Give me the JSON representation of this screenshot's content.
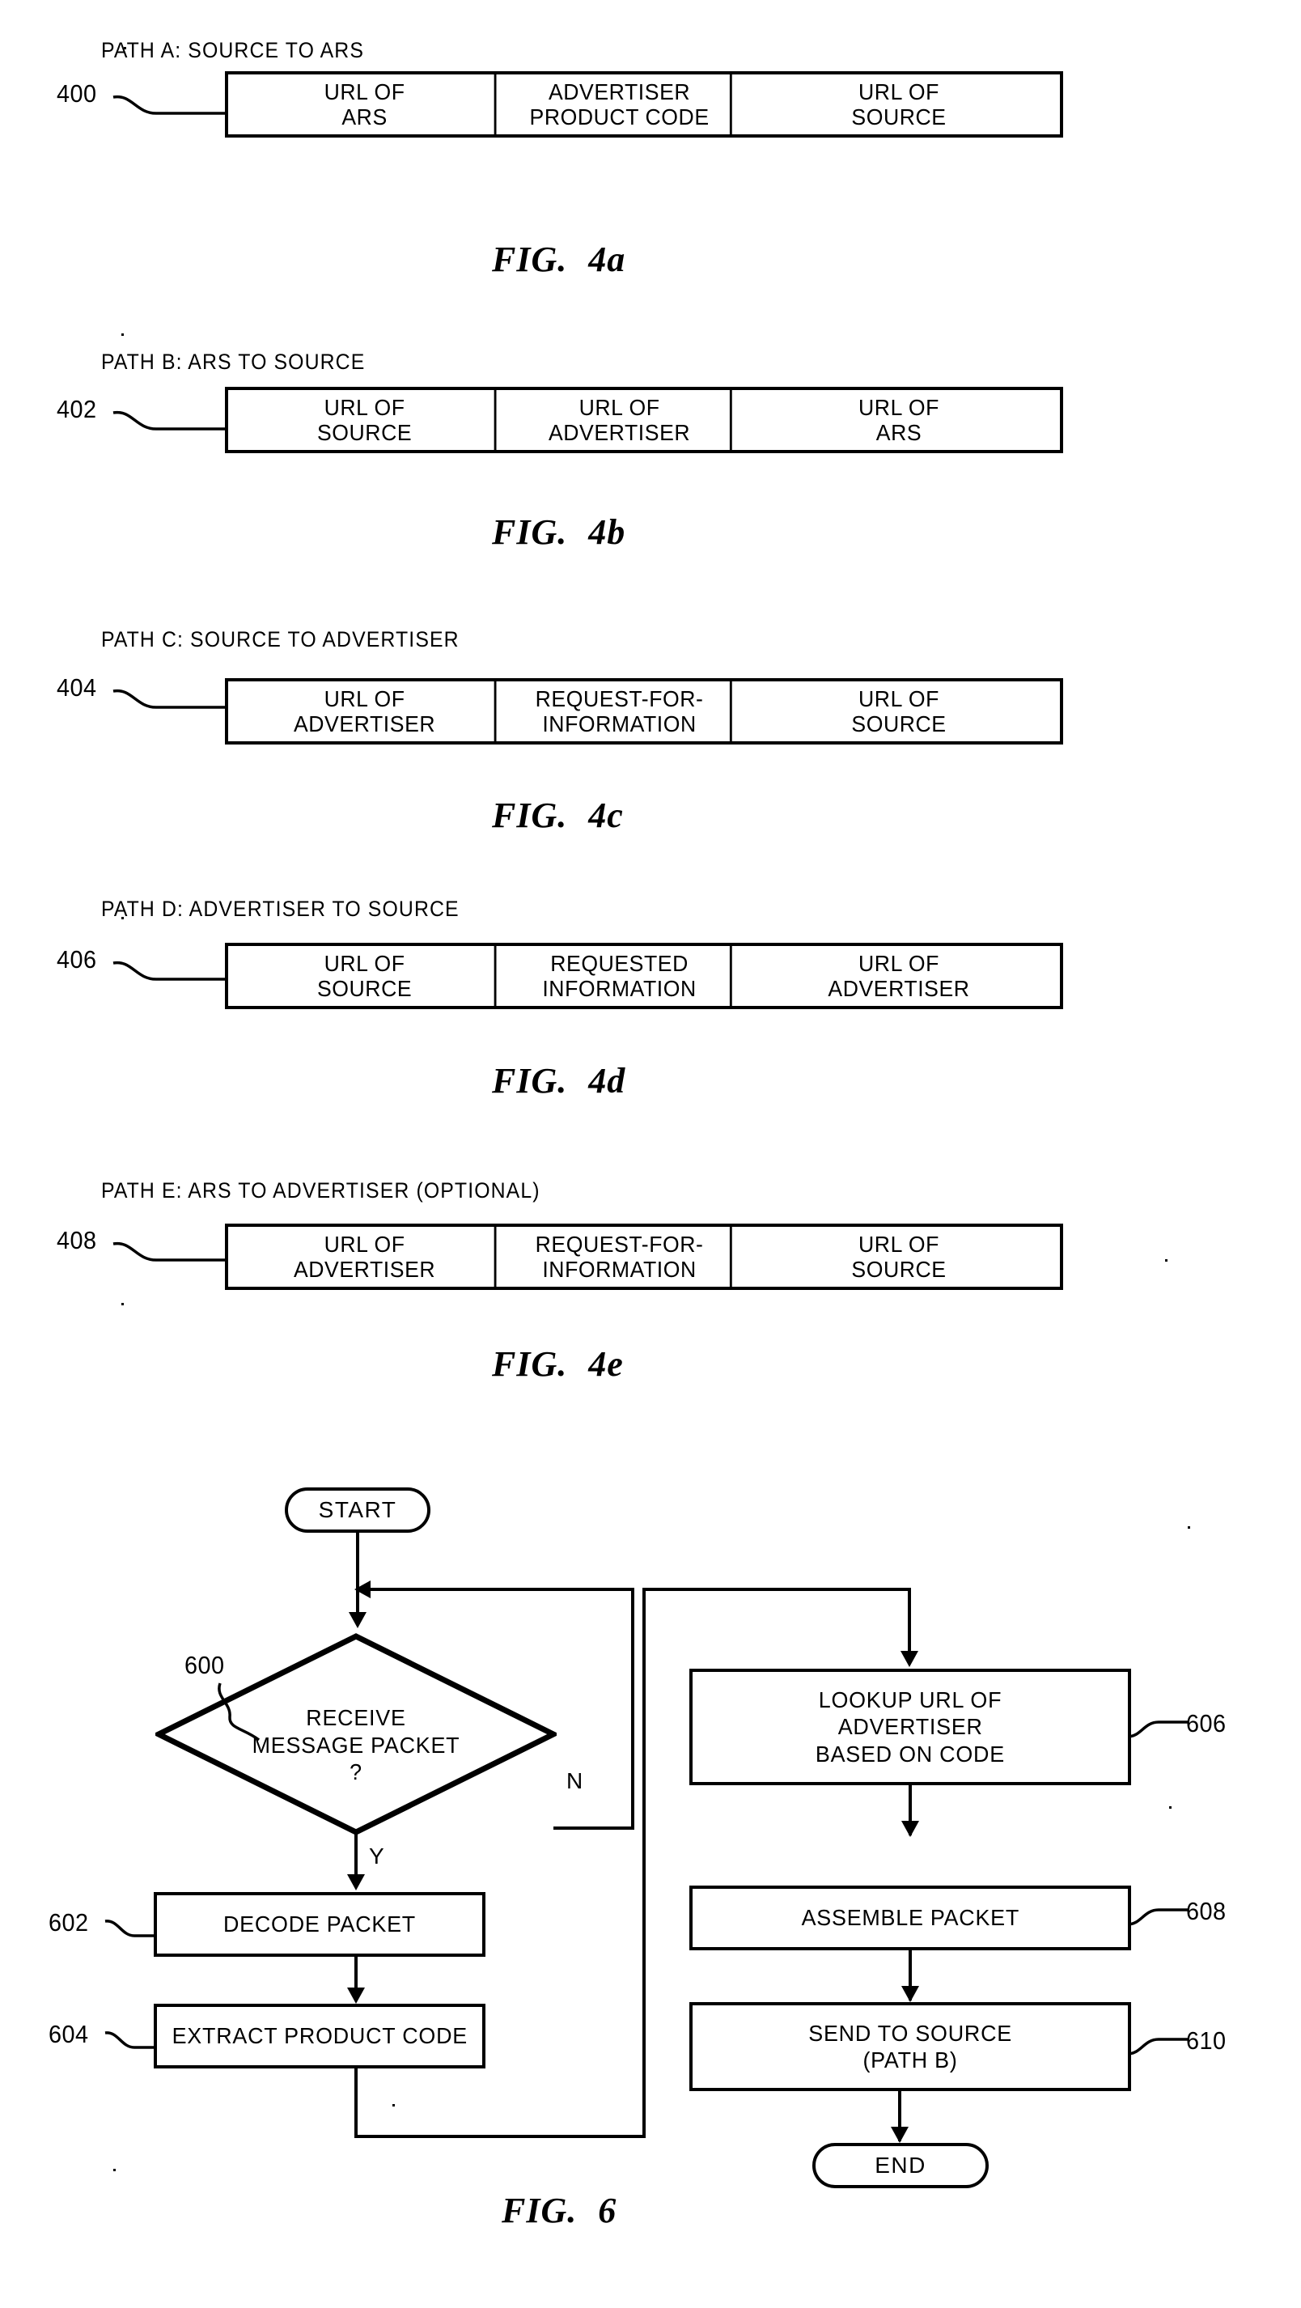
{
  "figures": [
    {
      "id": "fig-4a",
      "path_label": "PATH A: SOURCE TO ARS",
      "ref": "400",
      "caption_fig": "FIG.",
      "caption_num": "4a",
      "cells": [
        {
          "line1": "URL OF",
          "line2": "ARS"
        },
        {
          "line1": "ADVERTISER",
          "line2": "PRODUCT CODE"
        },
        {
          "line1": "URL OF",
          "line2": "SOURCE"
        }
      ]
    },
    {
      "id": "fig-4b",
      "path_label": "PATH B: ARS TO SOURCE",
      "ref": "402",
      "caption_fig": "FIG.",
      "caption_num": "4b",
      "cells": [
        {
          "line1": "URL OF",
          "line2": "SOURCE"
        },
        {
          "line1": "URL OF",
          "line2": "ADVERTISER"
        },
        {
          "line1": "URL OF",
          "line2": "ARS"
        }
      ]
    },
    {
      "id": "fig-4c",
      "path_label": "PATH C: SOURCE TO ADVERTISER",
      "ref": "404",
      "caption_fig": "FIG.",
      "caption_num": "4c",
      "cells": [
        {
          "line1": "URL OF",
          "line2": "ADVERTISER"
        },
        {
          "line1": "REQUEST-FOR-",
          "line2": "INFORMATION"
        },
        {
          "line1": "URL OF",
          "line2": "SOURCE"
        }
      ]
    },
    {
      "id": "fig-4d",
      "path_label": "PATH D: ADVERTISER TO SOURCE",
      "ref": "406",
      "caption_fig": "FIG.",
      "caption_num": "4d",
      "cells": [
        {
          "line1": "URL OF",
          "line2": "SOURCE"
        },
        {
          "line1": "REQUESTED",
          "line2": "INFORMATION"
        },
        {
          "line1": "URL OF",
          "line2": "ADVERTISER"
        }
      ]
    },
    {
      "id": "fig-4e",
      "path_label": "PATH E: ARS TO ADVERTISER (OPTIONAL)",
      "ref": "408",
      "caption_fig": "FIG.",
      "caption_num": "4e",
      "cells": [
        {
          "line1": "URL OF",
          "line2": "ADVERTISER"
        },
        {
          "line1": "REQUEST-FOR-",
          "line2": "INFORMATION"
        },
        {
          "line1": "URL OF",
          "line2": "SOURCE"
        }
      ]
    }
  ],
  "flowchart": {
    "caption_fig": "FIG.",
    "caption_num": "6",
    "start_label": "START",
    "end_label": "END",
    "decision": {
      "ref": "600",
      "line1": "RECEIVE",
      "line2": "MESSAGE PACKET",
      "line3": "?",
      "yes_label": "Y",
      "no_label": "N"
    },
    "steps": [
      {
        "ref": "602",
        "lines": [
          "DECODE PACKET"
        ]
      },
      {
        "ref": "604",
        "lines": [
          "EXTRACT PRODUCT CODE"
        ]
      },
      {
        "ref": "606",
        "lines": [
          "LOOKUP URL OF",
          "ADVERTISER",
          "BASED ON CODE"
        ]
      },
      {
        "ref": "608",
        "lines": [
          "ASSEMBLE PACKET"
        ]
      },
      {
        "ref": "610",
        "lines": [
          "SEND TO SOURCE",
          "(PATH B)"
        ]
      }
    ]
  }
}
